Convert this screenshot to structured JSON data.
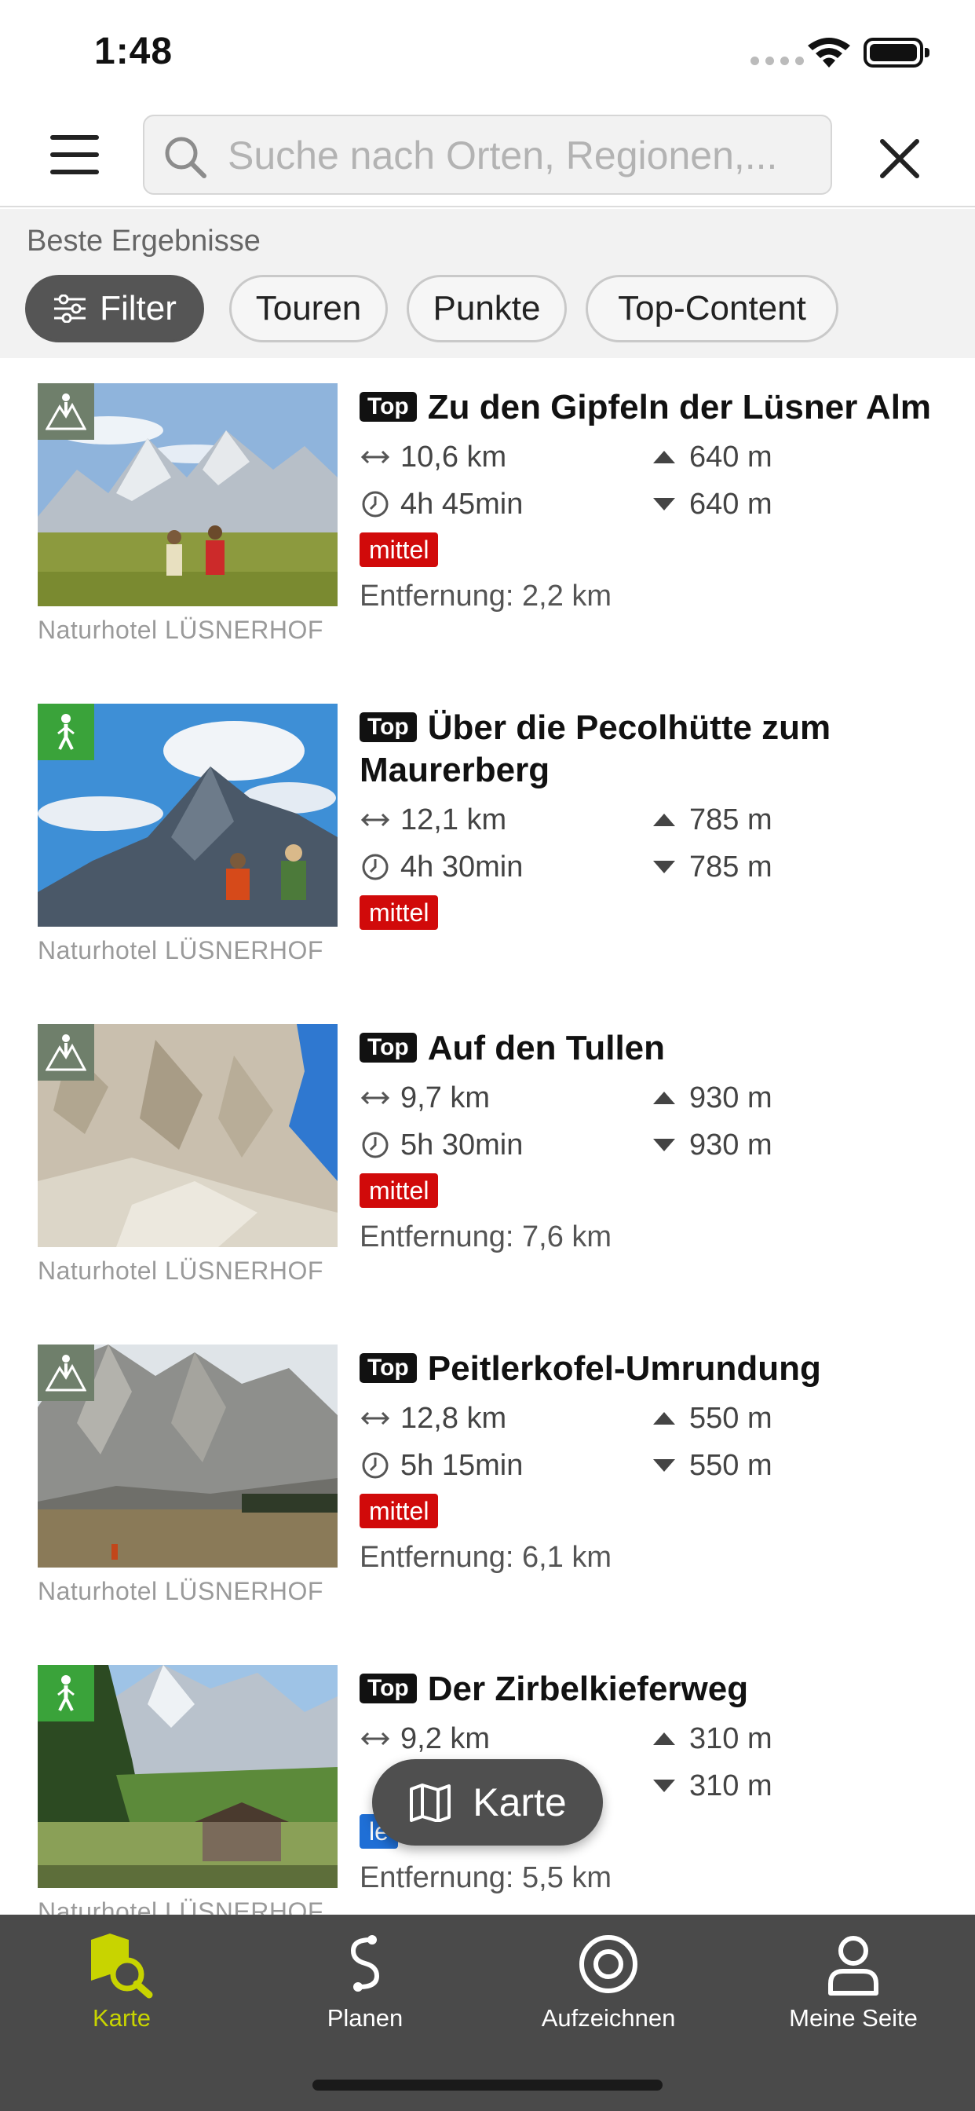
{
  "status_bar": {
    "time": "1:48"
  },
  "search": {
    "placeholder": "Suche nach Orten, Regionen,..."
  },
  "filter_bar": {
    "section_label": "Beste Ergebnisse",
    "chips": [
      {
        "label": "Filter",
        "active": true
      },
      {
        "label": "Touren",
        "active": false
      },
      {
        "label": "Punkte",
        "active": false
      },
      {
        "label": "Top-Content",
        "active": false
      }
    ]
  },
  "colors": {
    "accent": "#c8d400",
    "difficulty_medium": "#d10a0a",
    "difficulty_easy": "#1f6fd6",
    "tabbar_bg": "#4a4a4a",
    "activity_hiking": "#6f7f6b",
    "activity_walking": "#3aa33a"
  },
  "tours": [
    {
      "top_tag": "Top",
      "title": "Zu den Gipfeln der Lüsner Alm",
      "activity_icon": "hiking-icon",
      "distance": "10,6 km",
      "duration": "4h 45min",
      "ascent": "640 m",
      "descent": "640 m",
      "difficulty": "mittel",
      "proximity": "Entfernung: 2,2 km",
      "credit": "Naturhotel LÜSNERHOF"
    },
    {
      "top_tag": "Top",
      "title": "Über die Pecolhütte zum Maurerberg",
      "activity_icon": "walking-icon",
      "distance": "12,1 km",
      "duration": "4h 30min",
      "ascent": "785 m",
      "descent": "785 m",
      "difficulty": "mittel",
      "proximity": "",
      "credit": "Naturhotel LÜSNERHOF"
    },
    {
      "top_tag": "Top",
      "title": "Auf den Tullen",
      "activity_icon": "hiking-icon",
      "distance": "9,7 km",
      "duration": "5h 30min",
      "ascent": "930 m",
      "descent": "930 m",
      "difficulty": "mittel",
      "proximity": "Entfernung: 7,6 km",
      "credit": "Naturhotel LÜSNERHOF"
    },
    {
      "top_tag": "Top",
      "title": "Peitlerkofel-Umrundung",
      "activity_icon": "hiking-icon",
      "distance": "12,8 km",
      "duration": "5h 15min",
      "ascent": "550 m",
      "descent": "550 m",
      "difficulty": "mittel",
      "proximity": "Entfernung: 6,1 km",
      "credit": "Naturhotel LÜSNERHOF"
    },
    {
      "top_tag": "Top",
      "title": "Der Zirbelkieferweg",
      "activity_icon": "walking-icon",
      "distance": "9,2 km",
      "duration": "",
      "ascent": "310 m",
      "descent": "310 m",
      "difficulty": "le",
      "proximity": "Entfernung: 5,5 km",
      "credit": "Naturhotel LÜSNERHOF"
    }
  ],
  "map_button": {
    "label": "Karte"
  },
  "tabbar": {
    "tabs": [
      {
        "label": "Karte",
        "icon": "map-search-icon",
        "active": true
      },
      {
        "label": "Planen",
        "icon": "route-plan-icon",
        "active": false
      },
      {
        "label": "Aufzeichnen",
        "icon": "record-icon",
        "active": false
      },
      {
        "label": "Meine Seite",
        "icon": "person-icon",
        "active": false
      }
    ]
  }
}
